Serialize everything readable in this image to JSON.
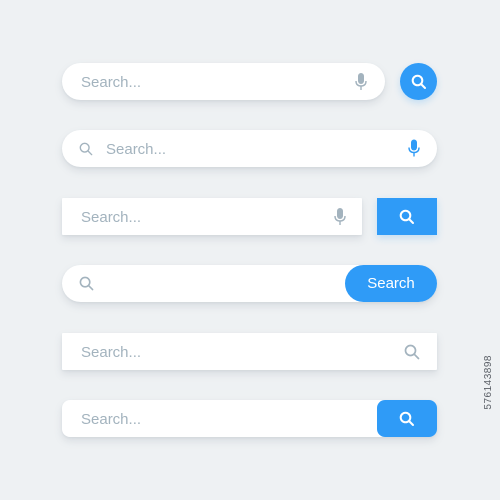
{
  "colors": {
    "background": "#eef1f3",
    "accent": "#2f9bf7",
    "placeholder": "#a3b3be",
    "icon_gray": "#a3b3be"
  },
  "bars": [
    {
      "placeholder": "Search...",
      "left_icon": null,
      "right_icon": "microphone-icon",
      "button": {
        "shape": "circle",
        "icon": "search-icon"
      }
    },
    {
      "placeholder": "Search...",
      "left_icon": "search-icon",
      "right_icon": "microphone-icon",
      "button": null
    },
    {
      "placeholder": "Search...",
      "left_icon": null,
      "right_icon": "microphone-icon",
      "button": {
        "shape": "square",
        "icon": "search-icon"
      }
    },
    {
      "placeholder": "",
      "left_icon": "search-icon",
      "right_icon": null,
      "button": {
        "shape": "pill",
        "label": "Search"
      }
    },
    {
      "placeholder": "Search...",
      "left_icon": null,
      "right_icon": "search-icon",
      "button": null
    },
    {
      "placeholder": "Search...",
      "left_icon": null,
      "right_icon": null,
      "button": {
        "shape": "rounded-rect",
        "icon": "search-icon"
      }
    }
  ],
  "watermark_id": "576143898"
}
